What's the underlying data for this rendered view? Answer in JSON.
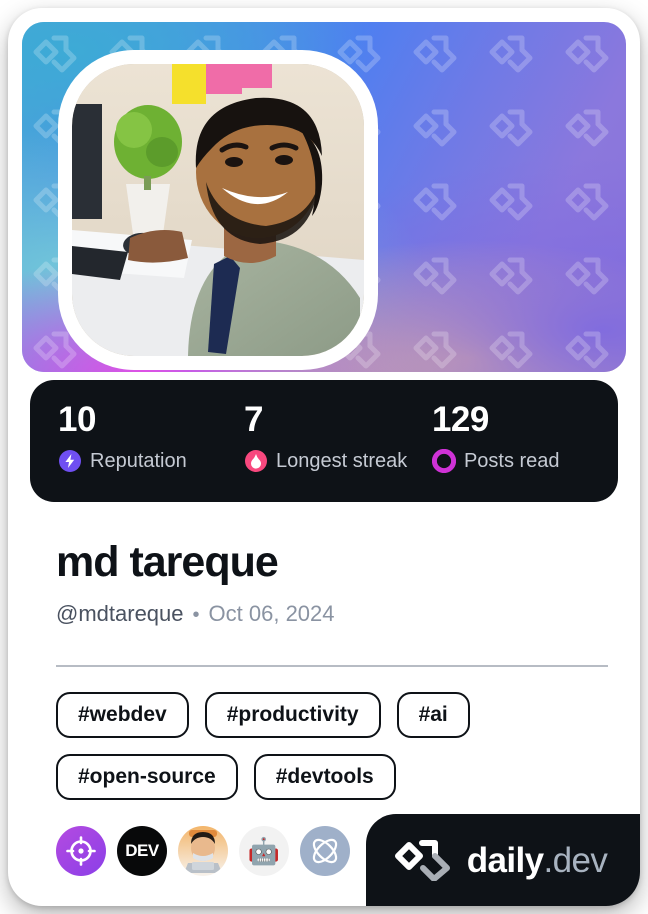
{
  "card": {
    "type": "devcard",
    "accent_dark": "#0e1217",
    "cover_gradient_from": "#4aa7d6",
    "cover_gradient_to": "#8b72d8"
  },
  "profile": {
    "display_name": "md tareque",
    "handle": "@mdtareque",
    "separator": "•",
    "joined_date": "Oct 06, 2024",
    "avatar_alt": "md tareque profile photo"
  },
  "stats": [
    {
      "value": "10",
      "label": "Reputation",
      "icon": "reputation-bolt-icon",
      "color": "#6f4ff2"
    },
    {
      "value": "7",
      "label": "Longest streak",
      "icon": "streak-flame-icon",
      "color": "#f8487e"
    },
    {
      "value": "129",
      "label": "Posts read",
      "icon": "posts-read-ring-icon",
      "color": "#cf32d6"
    }
  ],
  "tags": [
    "#webdev",
    "#productivity",
    "#ai",
    "#open-source",
    "#devtools"
  ],
  "sources": [
    {
      "name": "source-badge-target",
      "icon": "crosshair-target-icon"
    },
    {
      "name": "source-badge-dev",
      "icon": "dev-to-icon",
      "text": "DEV"
    },
    {
      "name": "source-badge-avatar",
      "icon": "person-avatar-icon"
    },
    {
      "name": "source-badge-robot",
      "icon": "robot-icon",
      "text": "🤖"
    },
    {
      "name": "source-badge-atom",
      "icon": "atom-icon"
    }
  ],
  "brand": {
    "logo_icon": "daily-dev-chevron-logo",
    "name_primary": "daily",
    "name_secondary": ".dev"
  }
}
